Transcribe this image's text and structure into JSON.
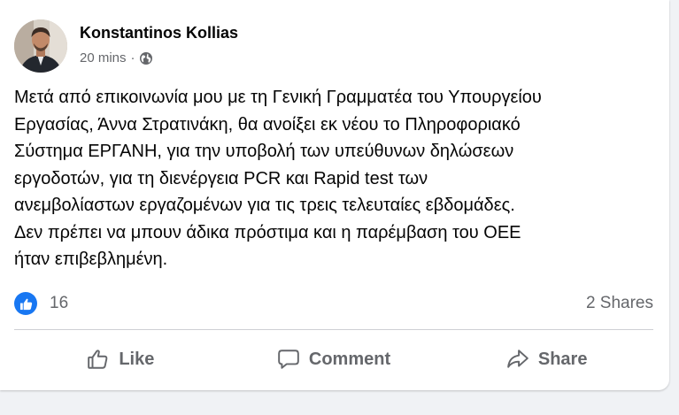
{
  "post": {
    "author": "Konstantinos Kollias",
    "timestamp": "20 mins",
    "separator": "·",
    "privacy_icon": "globe-icon",
    "text": "Μετά από επικοινωνία μου με τη Γενική Γραμματέα του Υπουργείου\nΕργασίας, Άννα Στρατινάκη, θα ανοίξει εκ νέου το Πληροφοριακό\nΣύστημα ΕΡΓΑΝΗ, για την υποβολή των υπεύθυνων δηλώσεων\nεργοδοτών, για τη διενέργεια PCR και Rapid test των\nανεμβολίαστων εργαζομένων για τις τρεις τελευταίες εβδομάδες.\nΔεν πρέπει να μπουν άδικα πρόστιμα και η παρέμβαση του ΟΕΕ\nήταν επιβεβλημένη."
  },
  "stats": {
    "reaction_icon": "like-badge-icon",
    "reaction_count": "16",
    "shares": "2 Shares"
  },
  "actions": {
    "like": "Like",
    "comment": "Comment",
    "share": "Share"
  },
  "colors": {
    "accent": "#1877f2",
    "secondary_text": "#65676b",
    "background": "#f0f2f5"
  }
}
